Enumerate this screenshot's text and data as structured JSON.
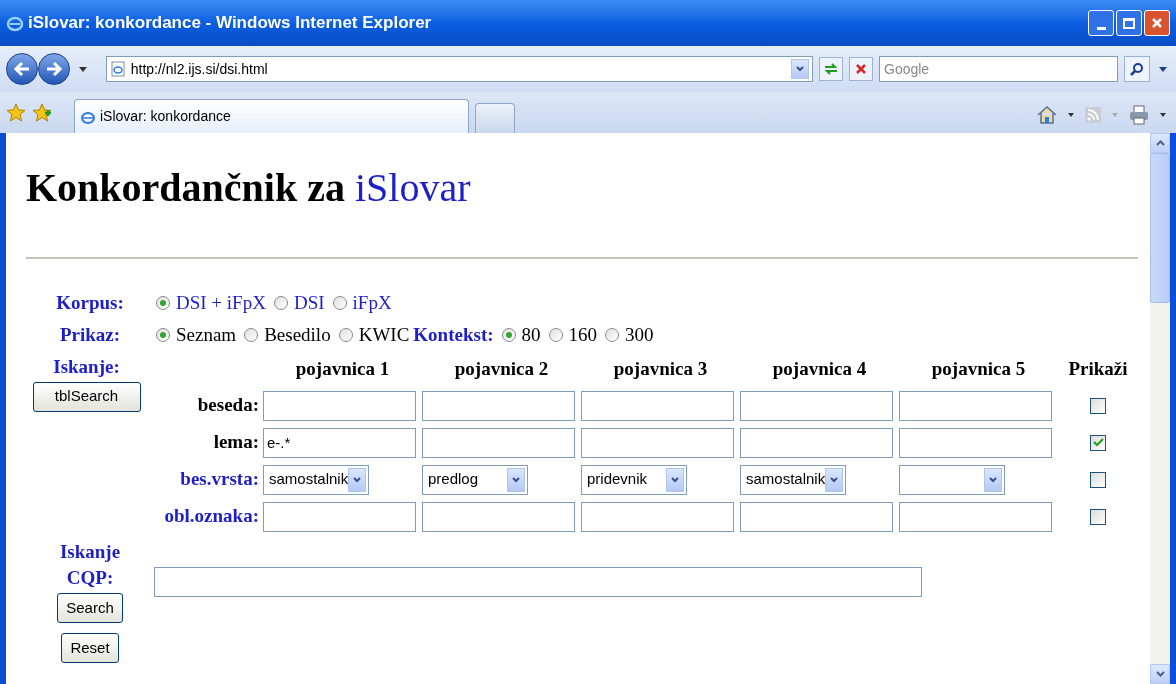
{
  "window": {
    "title": "iSlovar: konkordance - Windows Internet Explorer"
  },
  "address_bar": {
    "value": "http://nl2.ijs.si/dsi.html"
  },
  "search_box": {
    "placeholder": "Google"
  },
  "tabs": [
    {
      "label": "iSlovar: konkordance",
      "selected": true
    }
  ],
  "page": {
    "heading": {
      "text": "Konkordančnik za",
      "link": "iSlovar"
    },
    "korpus": {
      "label": "Korpus:",
      "link": true,
      "options": [
        {
          "label": "DSI + iFpX",
          "selected": true
        },
        {
          "label": "DSI",
          "selected": false
        },
        {
          "label": "iFpX",
          "selected": false
        }
      ]
    },
    "prikaz": {
      "label": "Prikaz:",
      "link": false,
      "options": [
        {
          "label": "Seznam",
          "selected": true
        },
        {
          "label": "Besedilo",
          "selected": false
        },
        {
          "label": "KWIC",
          "selected": false
        }
      ],
      "kontekst": {
        "label": "Kontekst:",
        "options": [
          {
            "label": "80",
            "selected": true
          },
          {
            "label": "160",
            "selected": false
          },
          {
            "label": "300",
            "selected": false
          }
        ]
      }
    },
    "iskanje": {
      "label": "Iskanje:",
      "button": "tblSearch"
    },
    "table": {
      "columns": [
        "pojavnica 1",
        "pojavnica 2",
        "pojavnica 3",
        "pojavnica 4",
        "pojavnica 5",
        "Prikaži"
      ],
      "rows": [
        {
          "label": "beseda:",
          "link": false,
          "kind": "text",
          "cells": [
            {},
            {},
            {},
            {},
            {}
          ],
          "show": {
            "checked": false
          }
        },
        {
          "label": "lema:",
          "link": false,
          "kind": "text",
          "cells": [
            {
              "value": "e-.*"
            },
            {},
            {},
            {},
            {}
          ],
          "show": {
            "checked": true
          }
        },
        {
          "label": "bes.vrsta:",
          "link": true,
          "kind": "select",
          "cells": [
            {
              "value": "samostalnik"
            },
            {
              "value": "predlog"
            },
            {
              "value": "pridevnik"
            },
            {
              "value": "samostalnik"
            },
            {}
          ],
          "show": {
            "checked": false
          }
        },
        {
          "label": "obl.oznaka:",
          "link": true,
          "kind": "text",
          "cells": [
            {},
            {},
            {},
            {},
            {}
          ],
          "show": {
            "checked": false
          }
        }
      ]
    },
    "cqp": {
      "label": "Iskanje CQP:",
      "buttons": [
        "Search",
        "Reset"
      ]
    }
  }
}
